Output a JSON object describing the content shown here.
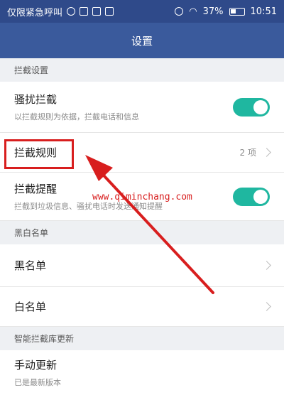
{
  "status_bar": {
    "carrier": "仅限紧急呼叫",
    "battery": "37%",
    "time": "10:51"
  },
  "header": {
    "title": "设置"
  },
  "sections": [
    {
      "header": "拦截设置",
      "items": [
        {
          "title": "骚扰拦截",
          "subtitle": "以拦截规则为依据，拦截电话和信息",
          "toggle": true
        },
        {
          "title": "拦截规则",
          "value": "2 项"
        },
        {
          "title": "拦截提醒",
          "subtitle": "拦截到垃圾信息、骚扰电话时发送通知提醒",
          "toggle": true
        }
      ]
    },
    {
      "header": "黑白名单",
      "items": [
        {
          "title": "黑名单"
        },
        {
          "title": "白名单"
        }
      ]
    },
    {
      "header": "智能拦截库更新",
      "items": [
        {
          "title": "手动更新",
          "subtitle": "已是最新版本"
        }
      ]
    }
  ],
  "annotation": {
    "watermark": "www.qiminchang.com",
    "highlight_color": "#d81e1e"
  },
  "colors": {
    "status_bar": "#2f4a8a",
    "title_bar": "#3a5a9c",
    "toggle_on": "#1fb7a0"
  }
}
